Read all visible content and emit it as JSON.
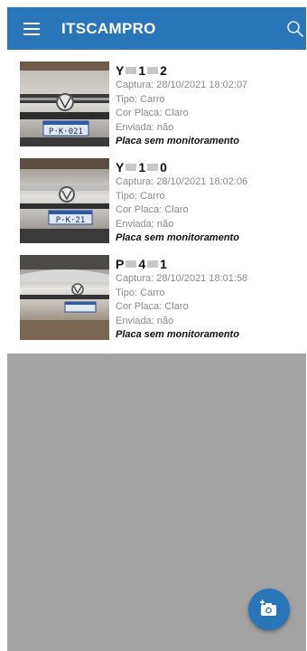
{
  "app": {
    "title": "ITSCAMPRO"
  },
  "icons": {
    "menu": "menu-icon",
    "search": "search-icon",
    "add_photo": "add-photo-camera-icon"
  },
  "colors": {
    "appbar": "#2a74b8",
    "fab": "#2a74b8",
    "background": "#a3a3a3"
  },
  "captures": [
    {
      "plate": {
        "c1": "Y",
        "c2": "1",
        "c3": "2"
      },
      "captura": "Captura: 28/10/2021 18:02:07",
      "tipo": "Tipo: Carro",
      "cor_placa": "Cor Placa: Claro",
      "enviada": "Enviada: não",
      "status": "Placa sem monitoramento",
      "photo_plate": "P·K·021"
    },
    {
      "plate": {
        "c1": "Y",
        "c2": "1",
        "c3": "0"
      },
      "captura": "Captura: 28/10/2021 18:02:06",
      "tipo": "Tipo: Carro",
      "cor_placa": "Cor Placa: Claro",
      "enviada": "Enviada: não",
      "status": "Placa sem monitoramento",
      "photo_plate": "P·K·21"
    },
    {
      "plate": {
        "c1": "P",
        "c2": "4",
        "c3": "1"
      },
      "captura": "Captura: 28/10/2021 18:01:58",
      "tipo": "Tipo: Carro",
      "cor_placa": "Cor Placa: Claro",
      "enviada": "Enviada: não",
      "status": "Placa sem monitoramento",
      "photo_plate": ""
    }
  ]
}
